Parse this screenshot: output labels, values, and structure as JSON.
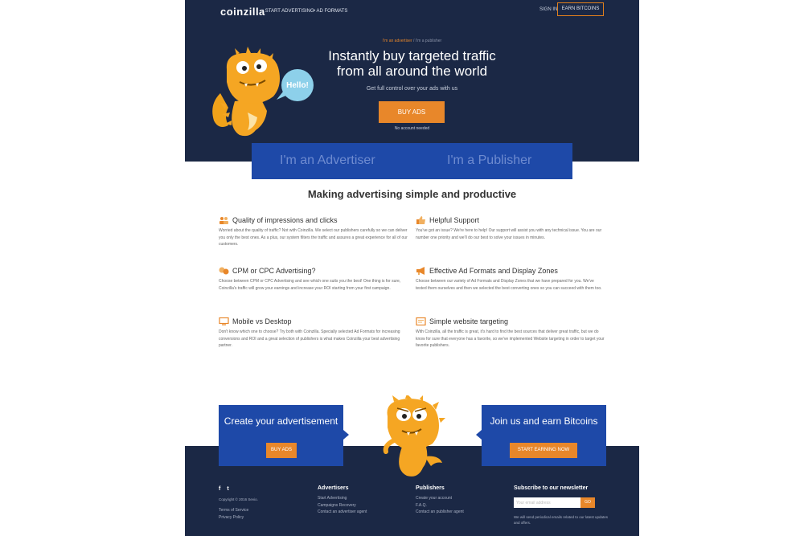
{
  "nav": {
    "logo": "coinzilla",
    "links": [
      "START ADVERTISING",
      "AD FORMATS"
    ],
    "sign_in": "SIGN IN",
    "earn_bitcoins": "EARN BITCOINS"
  },
  "hero": {
    "toggle_active": "I'm an advertiser",
    "toggle_separator": " / ",
    "toggle_inactive": "I'm a publisher",
    "speech_bubble": "Hello!",
    "title": "Instantly buy targeted traffic from all around the world",
    "subtitle": "Get full control over your ads with us",
    "cta_label": "BUY ADS",
    "cta_note": "No account needed"
  },
  "choices": {
    "advertiser": "I'm an Advertiser",
    "publisher": "I'm a Publisher"
  },
  "section_title": "Making advertising simple and productive",
  "features": [
    {
      "icon": "users-icon",
      "title": "Quality of impressions and clicks",
      "text": "Worried about the quality of traffic? Not with Coinzilla. We select our publishers carefully so we can deliver you only the best ones. As a plus, our system filters the traffic and assures a great experience for all of our customers."
    },
    {
      "icon": "thumbs-up-icon",
      "title": "Helpful Support",
      "text": "You've got an issue? We're here to help! Our support will assist you with any technical issue. You are our number one priority and we'll do our best to solve your issues in minutes."
    },
    {
      "icon": "coins-icon",
      "title": "CPM or CPC Advertising?",
      "text": "Choose between CPM or CPC Advertising and see which one suits you the best! One thing is for sure, Coinzilla's traffic will grow your earnings and increase your ROI starting from your first campaign."
    },
    {
      "icon": "megaphone-icon",
      "title": "Effective Ad Formats and Display Zones",
      "text": "Choose between our variety of Ad Formats and Display Zones that we have prepared for you. We've tested them ourselves and then we selected the best converting ones so you can succeed with them too."
    },
    {
      "icon": "desktop-icon",
      "title": "Mobile vs Desktop",
      "text": "Don't know which one to choose? Try both with Coinzilla. Specially selected Ad Formats for increasing conversions and ROI and a great selection of publishers is what makes Coinzilla your best advertising partner."
    },
    {
      "icon": "target-page-icon",
      "title": "Simple website targeting",
      "text": "With Coinzilla, all the traffic is great, it's hard to find the best sources that deliver great traffic, but we do know for sure that everyone has a favorite, so we've implemented Website targeting in order to target your favorite publishers."
    }
  ],
  "cta_left": {
    "title": "Create your advertisement",
    "button": "BUY ADS"
  },
  "cta_right": {
    "title": "Join us and earn Bitcoins",
    "button": "START EARNING NOW"
  },
  "footer": {
    "social": [
      "facebook-icon",
      "twitter-icon"
    ],
    "social_glyphs": [
      "f",
      "t"
    ],
    "copyright": "Copyright © 2016 Sevio.",
    "legal": [
      "Terms of Service",
      "Privacy Policy"
    ],
    "advertisers": {
      "heading": "Advertisers",
      "links": [
        "Start Advertising",
        "Campaigns Recovery",
        "Contact an advertiser agent"
      ]
    },
    "publishers": {
      "heading": "Publishers",
      "links": [
        "Create your account",
        "F.A.Q.",
        "Contact an publisher agent"
      ]
    },
    "newsletter": {
      "heading": "Subscribe to our newsletter",
      "placeholder": "Your email address",
      "button": "GO",
      "note": "We will send periodical emails related to our latest updates and offers."
    }
  },
  "colors": {
    "navy": "#1b2845",
    "blue": "#1e49a8",
    "orange": "#e8872a"
  }
}
